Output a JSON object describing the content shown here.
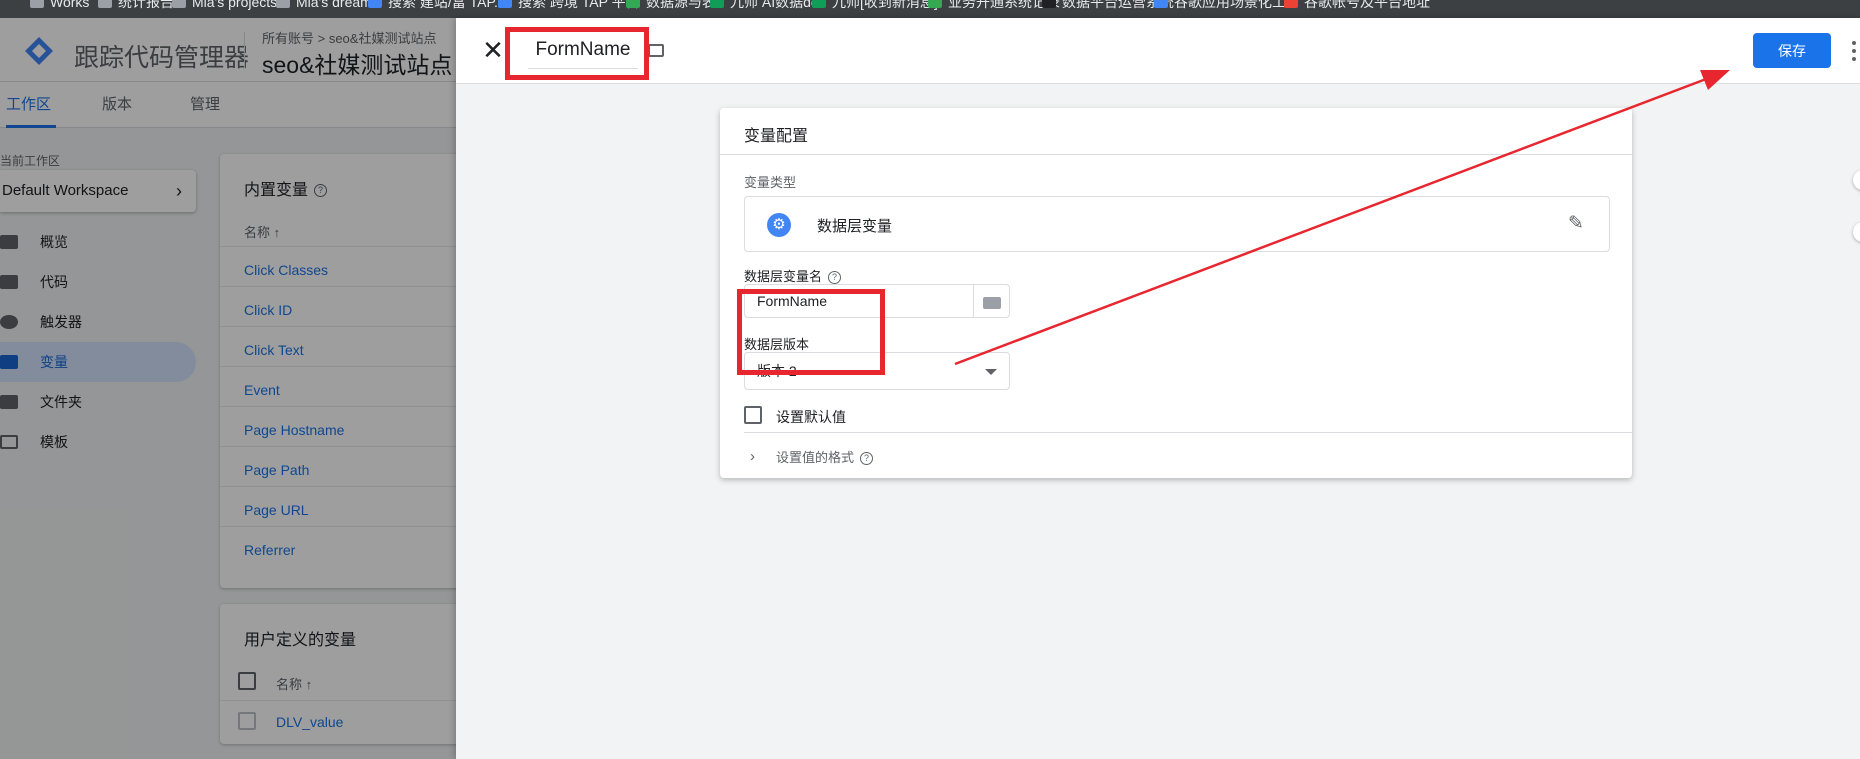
{
  "bookmarks": [
    "Works",
    "统计报告",
    "Mia's projects",
    "Mia's dream",
    "搜索 建站/富 TAP...",
    "搜索 跨境 TAP 平台",
    "数据源与表",
    "九师 AI数据dev",
    "九师[收到新消息]",
    "业务开通系统记录",
    "数据平台运营系统",
    "谷歌应用场景化工...",
    "谷歌帐号及平台地址"
  ],
  "app": {
    "title": "跟踪代码管理器",
    "account_crumb": "所有账号 > seo&社媒测试站点",
    "container": "seo&社媒测试站点",
    "tabs": [
      "工作区",
      "版本",
      "管理"
    ],
    "workspace_label": "当前工作区",
    "workspace": "Default Workspace",
    "nav": [
      "概览",
      "代码",
      "触发器",
      "变量",
      "文件夹",
      "模板"
    ],
    "builtin_card": {
      "title": "内置变量",
      "column": "名称 ↑",
      "items": [
        "Click Classes",
        "Click ID",
        "Click Text",
        "Event",
        "Page Hostname",
        "Page Path",
        "Page URL",
        "Referrer"
      ]
    },
    "user_card": {
      "title": "用户定义的变量",
      "column": "名称 ↑",
      "items": [
        "DLV_value"
      ]
    }
  },
  "editor": {
    "variable_name": "FormName",
    "save_label": "保存",
    "config_title": "变量配置",
    "type_label": "变量类型",
    "type_name": "数据层变量",
    "dl_name_label": "数据层变量名",
    "dl_name_value": "FormName",
    "version_label": "数据层版本",
    "version_value": "版本 2",
    "default_label": "设置默认值",
    "format_label": "设置值的格式"
  },
  "colors": {
    "accent": "#1a73e8",
    "annotation": "#e8262f"
  }
}
